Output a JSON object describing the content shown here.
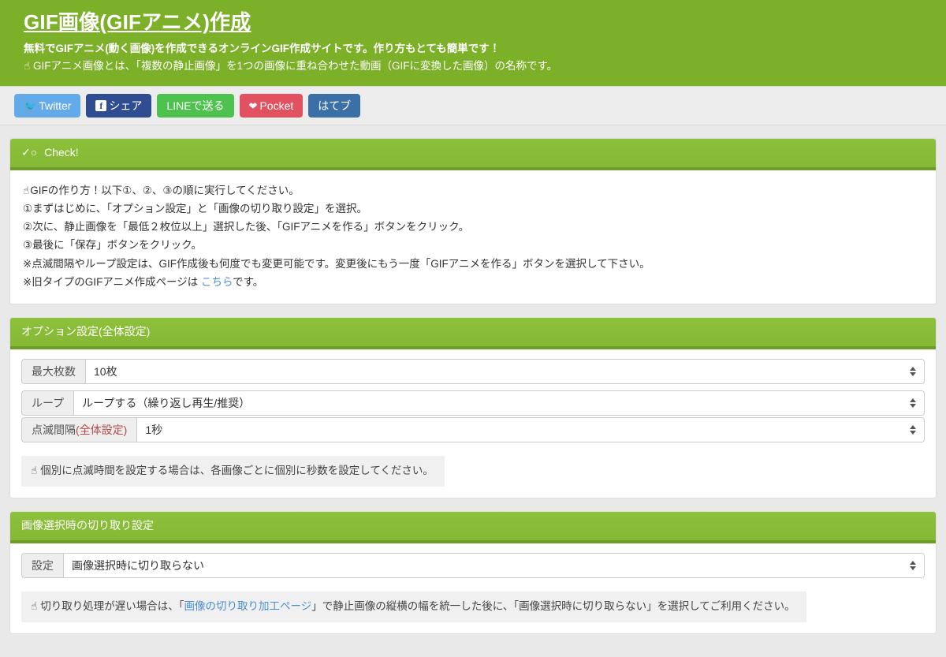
{
  "header": {
    "title": "GIF画像(GIFアニメ)作成",
    "desc_line1": "無料でGIFアニメ(動く画像)を作成できるオンラインGIF作成サイトです。作り方もとても簡単です！",
    "desc_line2_icon": "☝",
    "desc_line2": "GIFアニメ画像とは、「複数の静止画像」を1つの画像に重ね合わせた動画（GIFに変換した画像）の名称です。",
    "bg_color": "#7cb028"
  },
  "social": {
    "buttons": [
      {
        "label": "Twitter",
        "icon": "twitter-bird-icon",
        "glyph": "🐦",
        "color": "#63aae8"
      },
      {
        "label": "シェア",
        "icon": "facebook-icon",
        "glyph": "f",
        "color": "#314d92"
      },
      {
        "label": "LINEで送る",
        "icon": "",
        "glyph": "",
        "color": "#4ec14e"
      },
      {
        "label": "Pocket",
        "icon": "pocket-icon",
        "glyph": "♥",
        "color": "#e2515f"
      },
      {
        "label": "はてブ",
        "icon": "",
        "glyph": "",
        "color": "#3a6fa7"
      }
    ]
  },
  "check_panel": {
    "heading": "Check!",
    "heading_icon": "check-circle-icon",
    "lines": [
      {
        "icon": "☝",
        "text": "GIFの作り方！以下①、②、③の順に実行してください。"
      },
      {
        "icon": "",
        "text": "①まずはじめに、「オプション設定」と「画像の切り取り設定」を選択。"
      },
      {
        "icon": "",
        "text": "②次に、静止画像を「最低２枚位以上」選択した後、「GIFアニメを作る」ボタンをクリック。"
      },
      {
        "icon": "",
        "text": "③最後に「保存」ボタンをクリック。"
      },
      {
        "icon": "",
        "text": "※点滅間隔やループ設定は、GIF作成後も何度でも変更可能です。変更後にもう一度「GIFアニメを作る」ボタンを選択して下さい。"
      }
    ],
    "old_page_prefix": "※旧タイプのGIFアニメ作成ページは ",
    "old_page_link": "こちら",
    "old_page_suffix": "です。"
  },
  "option_panel": {
    "heading": "オプション設定(全体設定)",
    "fields": [
      {
        "label": "最大枚数",
        "value": "10枚",
        "label_red": ""
      },
      {
        "label": "ループ",
        "value": "ループする（繰り返し再生/推奨）",
        "label_red": ""
      },
      {
        "label": "点滅間隔",
        "label_red": "(全体設定)",
        "value": "1秒"
      }
    ],
    "hint_icon": "☝",
    "hint": "個別に点滅時間を設定する場合は、各画像ごとに個別に秒数を設定してください。"
  },
  "crop_panel": {
    "heading": "画像選択時の切り取り設定",
    "field": {
      "label": "設定",
      "value": "画像選択時に切り取らない"
    },
    "hint_icon": "☝",
    "hint_pre": "切り取り処理が遅い場合は、「",
    "hint_link": "画像の切り取り加工ページ",
    "hint_post": "」で静止画像の縦横の幅を統一した後に、「画像選択時に切り取らない」を選択してご利用ください。"
  }
}
